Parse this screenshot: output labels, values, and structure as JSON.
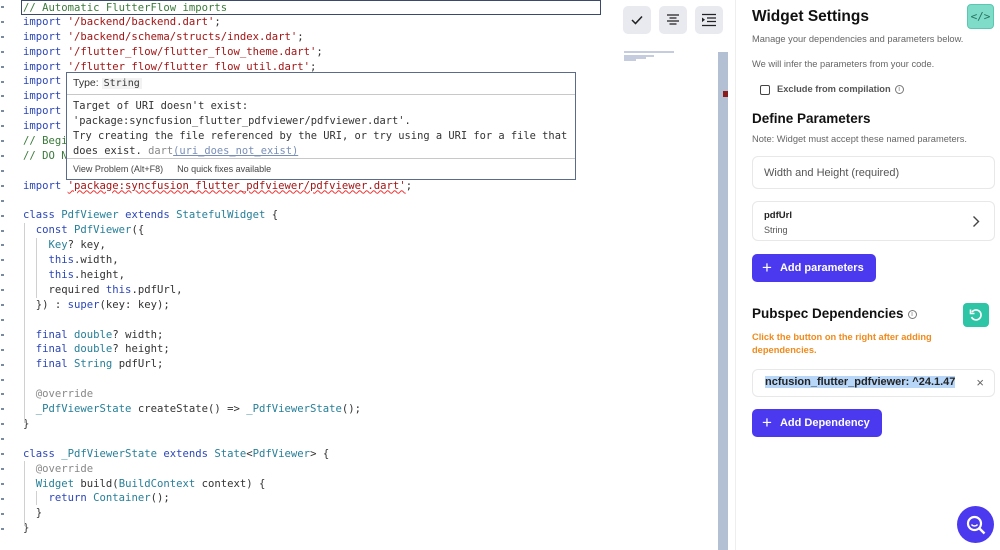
{
  "editor": {
    "code_lines": [
      [
        {
          "t": "// Automatic FlutterFlow imports",
          "c": "c"
        }
      ],
      [
        {
          "t": "import ",
          "c": "k"
        },
        {
          "t": "'/backend/backend.dart'",
          "c": "s"
        },
        {
          "t": ";",
          "c": "p"
        }
      ],
      [
        {
          "t": "import ",
          "c": "k"
        },
        {
          "t": "'/backend/schema/structs/index.dart'",
          "c": "s"
        },
        {
          "t": ";",
          "c": "p"
        }
      ],
      [
        {
          "t": "import ",
          "c": "k"
        },
        {
          "t": "'/flutter_flow/flutter_flow_theme.dart'",
          "c": "s"
        },
        {
          "t": ";",
          "c": "p"
        }
      ],
      [
        {
          "t": "import ",
          "c": "k"
        },
        {
          "t": "'/flutter_flow/flutter_flow_util.dart'",
          "c": "s"
        },
        {
          "t": ";",
          "c": "p"
        }
      ],
      [
        {
          "t": "import",
          "c": "k"
        }
      ],
      [
        {
          "t": "import",
          "c": "k"
        }
      ],
      [
        {
          "t": "import",
          "c": "k"
        }
      ],
      [
        {
          "t": "import",
          "c": "k"
        }
      ],
      [
        {
          "t": "// Begi",
          "c": "c"
        }
      ],
      [
        {
          "t": "// DO N",
          "c": "c"
        }
      ],
      [],
      [
        {
          "t": "import ",
          "c": "k"
        },
        {
          "t": "'package:syncfusion_flutter_pdfviewer/pdfviewer.dart'",
          "c": "s squig"
        },
        {
          "t": ";",
          "c": "p"
        }
      ],
      [],
      [
        {
          "t": "class ",
          "c": "k"
        },
        {
          "t": "PdfViewer ",
          "c": "t"
        },
        {
          "t": "extends ",
          "c": "k"
        },
        {
          "t": "StatefulWidget",
          "c": "t"
        },
        {
          "t": " {",
          "c": "p"
        }
      ],
      [
        {
          "t": "  const ",
          "c": "k"
        },
        {
          "t": "PdfViewer",
          "c": "t"
        },
        {
          "t": "({",
          "c": "p"
        }
      ],
      [
        {
          "t": "    Key",
          "c": "t"
        },
        {
          "t": "? key,",
          "c": "p"
        }
      ],
      [
        {
          "t": "    this",
          "c": "k"
        },
        {
          "t": ".width,",
          "c": "p"
        }
      ],
      [
        {
          "t": "    this",
          "c": "k"
        },
        {
          "t": ".height,",
          "c": "p"
        }
      ],
      [
        {
          "t": "    required ",
          "c": "p"
        },
        {
          "t": "this",
          "c": "k"
        },
        {
          "t": ".pdfUrl,",
          "c": "p"
        }
      ],
      [
        {
          "t": "  }) : ",
          "c": "p"
        },
        {
          "t": "super",
          "c": "k"
        },
        {
          "t": "(key: key);",
          "c": "p"
        }
      ],
      [],
      [
        {
          "t": "  final ",
          "c": "k"
        },
        {
          "t": "double",
          "c": "t"
        },
        {
          "t": "? width;",
          "c": "p"
        }
      ],
      [
        {
          "t": "  final ",
          "c": "k"
        },
        {
          "t": "double",
          "c": "t"
        },
        {
          "t": "? height;",
          "c": "p"
        }
      ],
      [
        {
          "t": "  final ",
          "c": "k"
        },
        {
          "t": "String",
          "c": "t"
        },
        {
          "t": " pdfUrl;",
          "c": "p"
        }
      ],
      [],
      [
        {
          "t": "  @override",
          "c": "g"
        }
      ],
      [
        {
          "t": "  _PdfViewerState",
          "c": "t"
        },
        {
          "t": " createState() => ",
          "c": "p"
        },
        {
          "t": "_PdfViewerState",
          "c": "t"
        },
        {
          "t": "();",
          "c": "p"
        }
      ],
      [
        {
          "t": "}",
          "c": "p"
        }
      ],
      [],
      [
        {
          "t": "class ",
          "c": "k"
        },
        {
          "t": "_PdfViewerState ",
          "c": "t"
        },
        {
          "t": "extends ",
          "c": "k"
        },
        {
          "t": "State",
          "c": "t"
        },
        {
          "t": "<",
          "c": "p"
        },
        {
          "t": "PdfViewer",
          "c": "t"
        },
        {
          "t": "> {",
          "c": "p"
        }
      ],
      [
        {
          "t": "  @override",
          "c": "g"
        }
      ],
      [
        {
          "t": "  Widget",
          "c": "t"
        },
        {
          "t": " build(",
          "c": "p"
        },
        {
          "t": "BuildContext",
          "c": "t"
        },
        {
          "t": " context) {",
          "c": "p"
        }
      ],
      [
        {
          "t": "    return ",
          "c": "k"
        },
        {
          "t": "Container",
          "c": "t"
        },
        {
          "t": "();",
          "c": "p"
        }
      ],
      [
        {
          "t": "  }",
          "c": "p"
        }
      ],
      [
        {
          "t": "}",
          "c": "p"
        }
      ]
    ],
    "tooltip": {
      "type_label": "Type:",
      "type_value": "String",
      "message": "Target of URI doesn't exist:\n'package:syncfusion_flutter_pdfviewer/pdfviewer.dart'.\nTry creating the file referenced by the URI, or try using a URI for a file that\ndoes exist. ",
      "source": "dart",
      "code_link": "(uri_does_not_exist)",
      "view_problem": "View Problem (Alt+F8)",
      "no_fixes": "No quick fixes available"
    },
    "toolbar": [
      "check-icon",
      "format-align-center-icon",
      "format-indent-icon"
    ]
  },
  "panel": {
    "title": "Widget Settings",
    "code_button": "</>",
    "description1": "Manage your dependencies and parameters below.",
    "description2": "We will infer the parameters from your code.",
    "exclude_label": "Exclude from compilation",
    "exclude_checked": false,
    "define_title": "Define Parameters",
    "define_note": "Note: Widget must accept these named parameters.",
    "width_height": "Width and Height (required)",
    "param": {
      "name": "pdfUrl",
      "type": "String"
    },
    "add_params": "Add parameters",
    "pubspec_title": "Pubspec Dependencies",
    "pubspec_note": "Click the button on the right after adding dependencies.",
    "dependency_value": "ncfusion_flutter_pdfviewer: ^24.1.47",
    "add_dependency": "Add Dependency"
  },
  "colors": {
    "accent": "#4b39ef",
    "teal": "#2dc5a5",
    "warning": "#f08a1c"
  }
}
